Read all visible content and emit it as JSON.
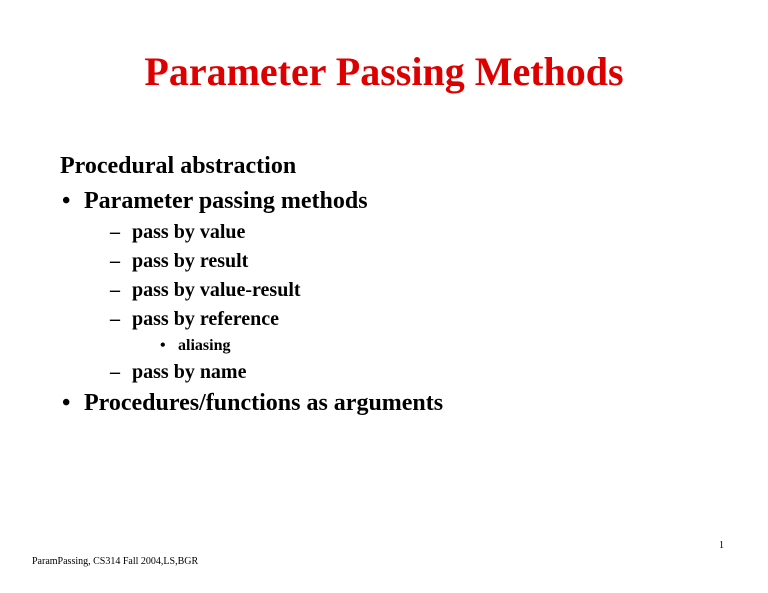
{
  "title": "Parameter Passing Methods",
  "heading": "Procedural abstraction",
  "items": [
    {
      "level": 1,
      "text": "Parameter passing methods"
    },
    {
      "level": 2,
      "text": "pass by value"
    },
    {
      "level": 2,
      "text": "pass by result"
    },
    {
      "level": 2,
      "text": "pass by value-result"
    },
    {
      "level": 2,
      "text": "pass by reference"
    },
    {
      "level": 3,
      "text": "aliasing"
    },
    {
      "level": 2,
      "text": "pass by name"
    },
    {
      "level": 1,
      "text": "Procedures/functions as arguments"
    }
  ],
  "footer": {
    "left": "ParamPassing, CS314 Fall 2004,LS,BGR",
    "right": "1"
  }
}
